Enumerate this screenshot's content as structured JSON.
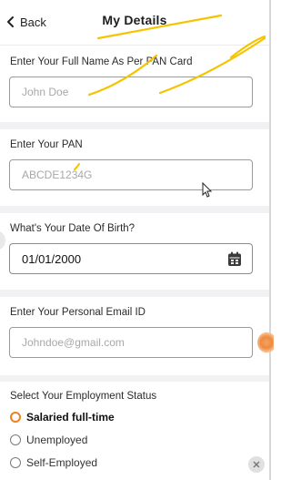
{
  "header": {
    "back_label": "Back",
    "title": "My Details"
  },
  "form": {
    "full_name": {
      "label": "Enter Your Full Name As Per PAN Card",
      "placeholder": "John Doe"
    },
    "pan": {
      "label": "Enter Your PAN",
      "placeholder": "ABCDE1234G"
    },
    "dob": {
      "label": "What's Your Date Of Birth?",
      "value": "01/01/2000"
    },
    "email": {
      "label": "Enter Your Personal Email ID",
      "placeholder": "Johndoe@gmail.com"
    },
    "employment": {
      "label": "Select Your Employment Status",
      "options": [
        {
          "label": "Salaried full-time",
          "selected": true
        },
        {
          "label": "Unemployed",
          "selected": false
        },
        {
          "label": "Self-Employed",
          "selected": false
        }
      ]
    }
  },
  "colors": {
    "accent": "#f07f1c",
    "annotation": "#f5c400",
    "section_gap": "#f2f2f4"
  },
  "icons": [
    "chevron-left-icon",
    "calendar-icon",
    "close-icon",
    "mouse-pointer-icon"
  ]
}
